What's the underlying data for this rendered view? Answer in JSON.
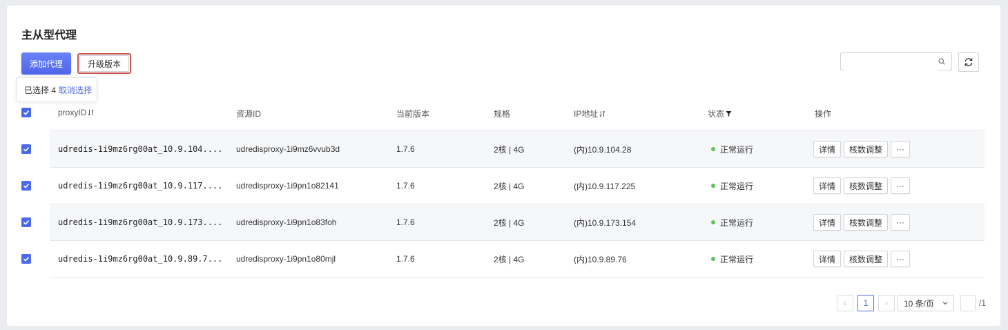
{
  "title": "主从型代理",
  "toolbar": {
    "add_label": "添加代理",
    "upgrade_label": "升级版本",
    "selection_prefix": "已选择 4",
    "cancel_selection": "取消选择",
    "search_placeholder": ""
  },
  "colors": {
    "accent": "#4a69e8",
    "status_running": "#5cc25a",
    "highlight_border": "#c9534f"
  },
  "table": {
    "columns": [
      "proxyID",
      "资源ID",
      "当前版本",
      "规格",
      "IP地址",
      "状态",
      "操作"
    ],
    "rows": [
      {
        "proxy_id": "udredis-1i9mz6rg00at_10.9.104....",
        "resource_id": "udredisproxy-1i9mz6vvub3d",
        "version": "1.7.6",
        "spec": "2核 | 4G",
        "ip": "(内)10.9.104.28",
        "status": "正常运行",
        "selected": true
      },
      {
        "proxy_id": "udredis-1i9mz6rg00at_10.9.117....",
        "resource_id": "udredisproxy-1i9pn1o82141",
        "version": "1.7.6",
        "spec": "2核 | 4G",
        "ip": "(内)10.9.117.225",
        "status": "正常运行",
        "selected": true
      },
      {
        "proxy_id": "udredis-1i9mz6rg00at_10.9.173....",
        "resource_id": "udredisproxy-1i9pn1o83foh",
        "version": "1.7.6",
        "spec": "2核 | 4G",
        "ip": "(内)10.9.173.154",
        "status": "正常运行",
        "selected": true
      },
      {
        "proxy_id": "udredis-1i9mz6rg00at_10.9.89.7...",
        "resource_id": "udredisproxy-1i9pn1o80mjl",
        "version": "1.7.6",
        "spec": "2核 | 4G",
        "ip": "(内)10.9.89.76",
        "status": "正常运行",
        "selected": true
      }
    ],
    "actions": {
      "detail": "详情",
      "resize": "核数调整",
      "more": "···"
    }
  },
  "pagination": {
    "prev_icon": "‹",
    "next_icon": "›",
    "current_page": "1",
    "page_size": "10 条/页",
    "page_input": "",
    "total": "/1"
  }
}
